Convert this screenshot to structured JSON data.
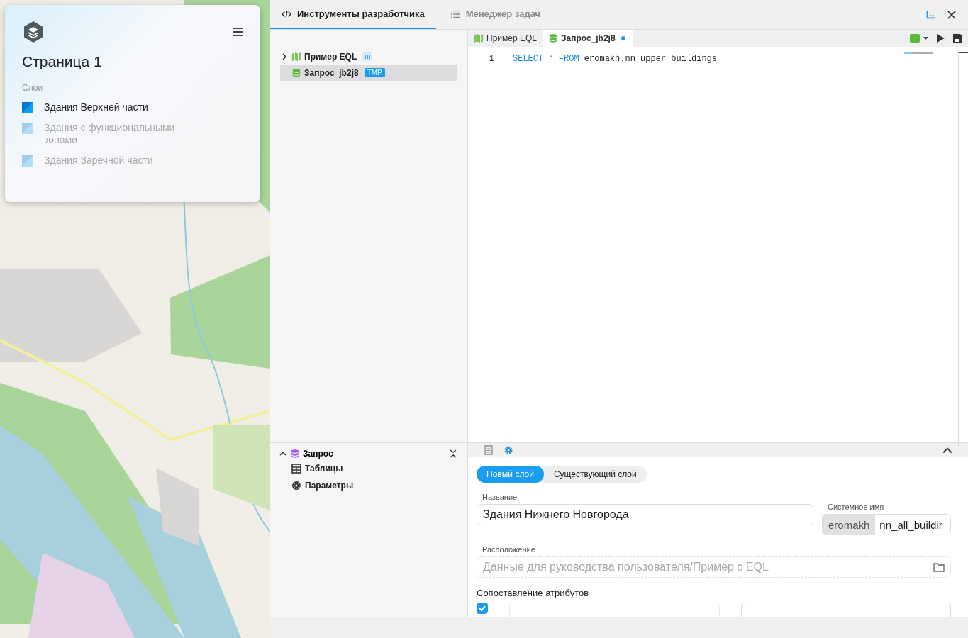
{
  "layers_card": {
    "title": "Страница 1",
    "section_label": "Слои",
    "layers": [
      {
        "name": "Здания Верхней части",
        "visible": true
      },
      {
        "name": "Здания с функциональными зонами",
        "visible": false
      },
      {
        "name": "Здания Заречной части",
        "visible": false
      }
    ]
  },
  "top_tabs": [
    {
      "label": "Инструменты разработчика",
      "kind": "code",
      "selected": true
    },
    {
      "label": "Менеджер задач",
      "kind": "list",
      "selected": false
    }
  ],
  "tree": [
    {
      "label": "Пример EQL",
      "kind": "map",
      "expanded": false,
      "selected": false
    },
    {
      "label": "Запрос_jb2j8",
      "kind": "query",
      "badge": "TMP",
      "selected": true
    }
  ],
  "editor_tabs": [
    {
      "label": "Пример EQL",
      "kind": "map",
      "selected": false,
      "modified": false
    },
    {
      "label": "Запрос_jb2j8",
      "kind": "query",
      "selected": true,
      "modified": true
    }
  ],
  "editor": {
    "lines": [
      {
        "number": "1",
        "tokens": [
          {
            "text": "SELECT",
            "kind": "keyword"
          },
          {
            "text": "*",
            "kind": "operator"
          },
          {
            "text": "FROM",
            "kind": "keyword"
          },
          {
            "text": "eromakh.nn_upper_buildings",
            "kind": "name"
          }
        ]
      }
    ]
  },
  "outline": {
    "title": "Запрос",
    "expanded": true,
    "items": [
      {
        "label": "Таблицы",
        "kind": "table"
      },
      {
        "label": "Параметры",
        "kind": "param"
      }
    ]
  },
  "properties": {
    "icon_tabs": [
      {
        "kind": "document",
        "selected": false
      },
      {
        "kind": "settings",
        "selected": true
      }
    ],
    "mode_tabs": [
      {
        "label": "Новый слой",
        "selected": true
      },
      {
        "label": "Существующий слой",
        "selected": false
      }
    ],
    "name_label": "Название",
    "name_value": "Здания Нижнего Новгорода",
    "system_label": "Системное имя",
    "schema": "eromakh",
    "system_value": "nn_all_buildir",
    "location_label": "Расположение",
    "location_placeholder": "Данные для руководства пользователя/Пример с EQL",
    "mapping_title": "Сопоставление атрибутов",
    "mapping_rows": [
      {
        "checked": true
      }
    ]
  }
}
